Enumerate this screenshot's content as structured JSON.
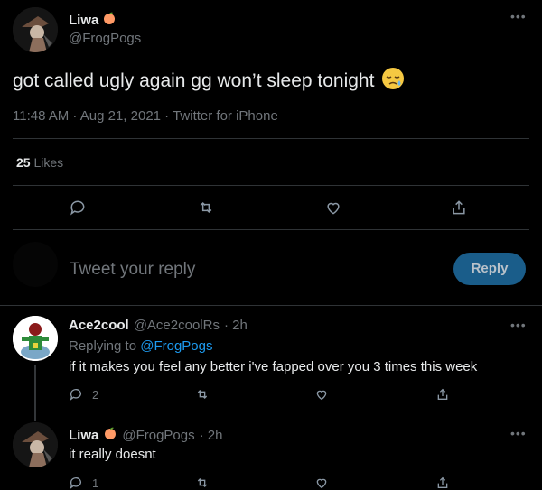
{
  "colors": {
    "background": "#000000",
    "text": "#e7e9ea",
    "muted": "#71767b",
    "accent": "#1d9bf0",
    "divider": "#2f3336",
    "peach": "#ff9a66"
  },
  "main_tweet": {
    "author_name": "Liwa",
    "author_badge_icon": "peach-emoji",
    "author_handle": "@FrogPogs",
    "text": "got called ugly again gg won’t sleep tonight",
    "emoji_icon": "sleepy-face-emoji",
    "meta": "11:48 AM · Aug 21, 2021 · Twitter for iPhone",
    "likes_count": "25",
    "likes_label": "Likes"
  },
  "reply_composer": {
    "placeholder": "Tweet your reply",
    "button_label": "Reply"
  },
  "replies": [
    {
      "author_name": "Ace2cool",
      "author_handle": "@Ace2coolRs",
      "time": "· 2h",
      "replying_prefix": "Replying to",
      "replying_to": "@FrogPogs",
      "text": "if it makes you feel any better i've fapped over you 3 times this week",
      "reply_count": "2"
    },
    {
      "author_name": "Liwa",
      "author_handle": "@FrogPogs",
      "time": "· 2h",
      "text": "it really doesnt",
      "reply_count": "1"
    }
  ]
}
